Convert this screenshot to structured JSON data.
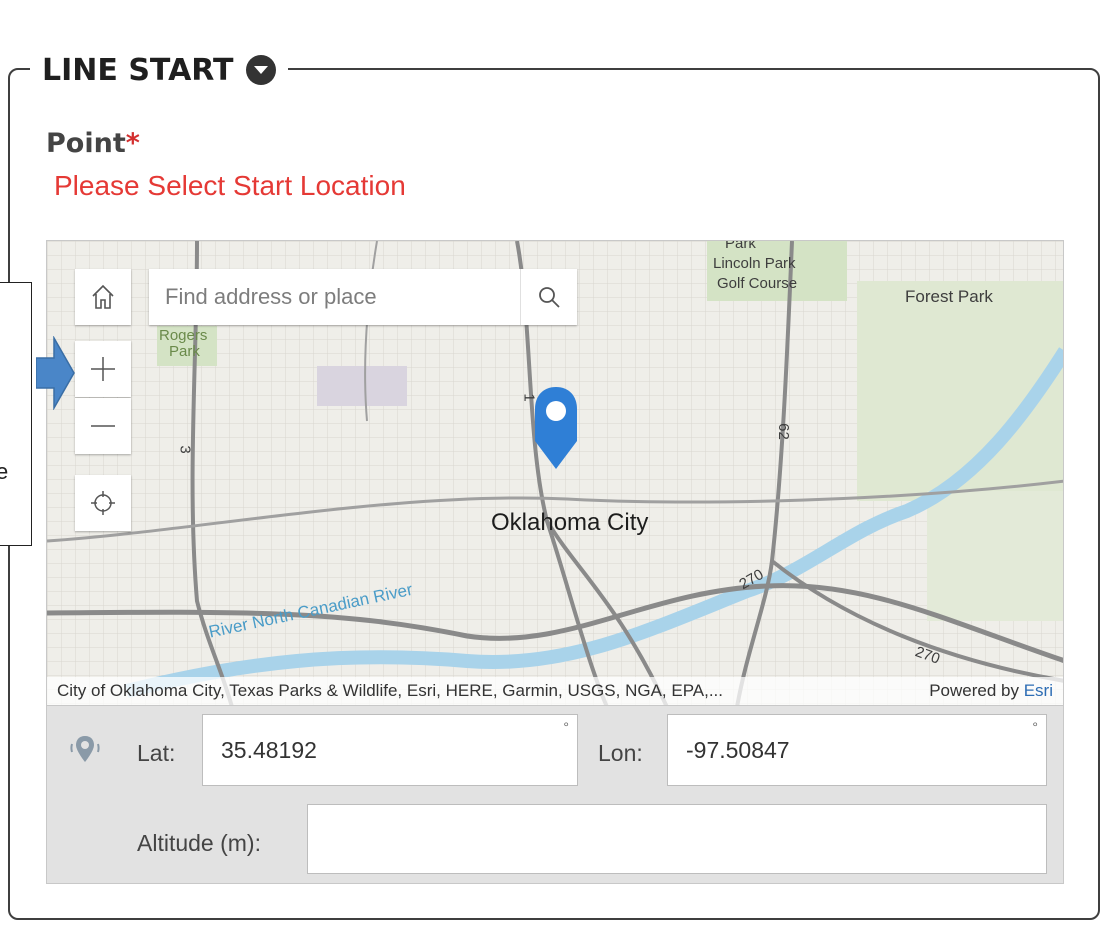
{
  "section": {
    "title": "LINE START"
  },
  "point": {
    "label": "Point",
    "required_mark": "*",
    "error": "Please Select Start Location"
  },
  "map": {
    "search_placeholder": "Find address or place",
    "city": "Oklahoma City",
    "labels": {
      "lincoln_park": "Lincoln Park",
      "golf_course": "Golf Course",
      "park_fragment": "Park",
      "forest_park": "Forest Park",
      "rogers": "Rogers",
      "rogers_park": "Park",
      "river": "River North Canadian River",
      "route_3": "3",
      "route_62": "62",
      "route_270a": "270",
      "route_270b": "270",
      "route_1": "1"
    },
    "attribution": "City of Oklahoma City, Texas Parks & Wildlife, Esri, HERE, Garmin, USGS, NGA, EPA,...",
    "powered_prefix": "Powered by ",
    "powered_link": "Esri",
    "marker_color": "#2f7fd6"
  },
  "coords": {
    "lat_label": "Lat:",
    "lat_value": "35.48192",
    "lon_label": "Lon:",
    "lon_value": "-97.50847",
    "alt_label": "Altitude (m):",
    "alt_value": "",
    "degree_symbol": "°"
  },
  "callout": {
    "text_fragment": "e",
    "arrow_color": "#4a86c8"
  },
  "colors": {
    "error": "#e53935",
    "required": "#d32f2f"
  }
}
